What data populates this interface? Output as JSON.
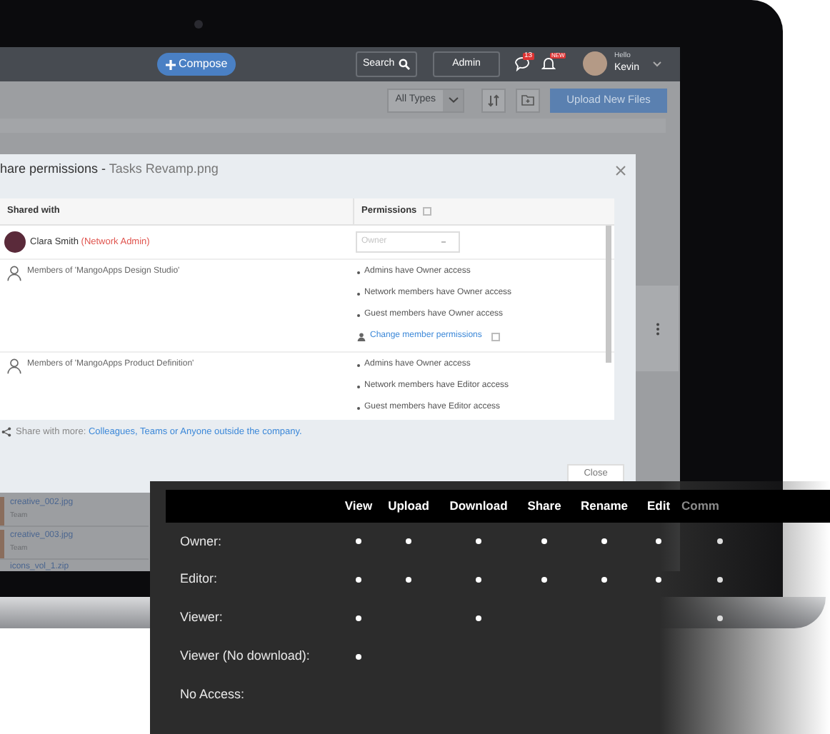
{
  "top_bar": {
    "compose": "Compose",
    "search": "Search",
    "admin": "Admin",
    "chat_badge": "13",
    "alert_badge": "NEW",
    "greeting": "Hello",
    "user": "Kevin"
  },
  "toolbar": {
    "type_filter": "All Types",
    "upload": "Upload New Files"
  },
  "files": [
    {
      "name": "creative_002.jpg",
      "owner": "Team"
    },
    {
      "name": "creative_003.jpg",
      "owner": "Team"
    },
    {
      "name": "icons_vol_1.zip"
    }
  ],
  "dialog": {
    "title": "hare permissions - ",
    "file": "Tasks Revamp.png",
    "columns": [
      "Shared with",
      "Permissions"
    ],
    "owner_row": {
      "name": "Clara Smith",
      "role": "(Network Admin)",
      "permission": "Owner"
    },
    "groups": [
      {
        "name": "Members of 'MangoApps Design Studio'",
        "rules": [
          "Admins have Owner access",
          "Network members have Owner access",
          "Guest members have Owner access"
        ],
        "link": "Change member permissions"
      },
      {
        "name": "Members of 'MangoApps Product Definition'",
        "rules": [
          "Admins have Owner access",
          "Network members have Editor access",
          "Guest members have Editor access"
        ]
      }
    ],
    "share_label": "Share with more:",
    "share_link": "Colleagues, Teams or Anyone outside the company.",
    "close": "Close"
  },
  "matrix": {
    "columns": [
      "View",
      "Upload",
      "Download",
      "Share",
      "Rename",
      "Edit",
      "Comm"
    ],
    "rows": [
      {
        "label": "Owner:",
        "cells": [
          true,
          true,
          true,
          true,
          true,
          true,
          true
        ]
      },
      {
        "label": "Editor:",
        "cells": [
          true,
          true,
          true,
          true,
          true,
          true,
          true
        ]
      },
      {
        "label": "Viewer:",
        "cells": [
          true,
          false,
          true,
          false,
          false,
          false,
          true
        ]
      },
      {
        "label": "Viewer (No download):",
        "cells": [
          true,
          false,
          false,
          false,
          false,
          false,
          false
        ]
      },
      {
        "label": "No Access:",
        "cells": [
          false,
          false,
          false,
          false,
          false,
          false,
          false
        ]
      }
    ]
  }
}
